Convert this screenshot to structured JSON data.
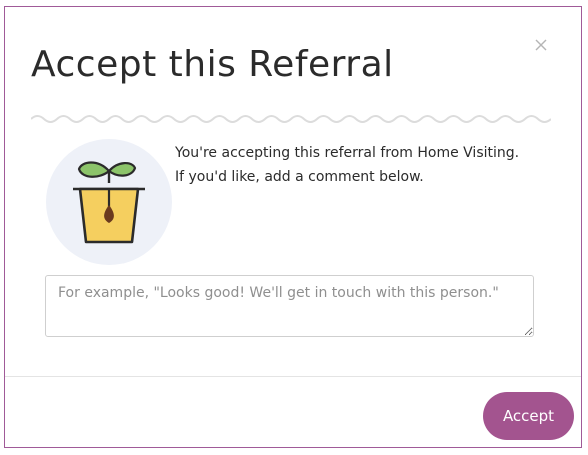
{
  "dialog": {
    "title": "Accept this Referral",
    "close_icon": "close-icon",
    "illustration_icon": "seedling-pot-icon",
    "message_line1": "You're accepting this referral from Home Visiting.",
    "message_line2": "If you'd like, add a comment below.",
    "comment": {
      "value": "",
      "placeholder": "For example, \"Looks good! We'll get in touch with this person.\""
    },
    "accept_label": "Accept"
  },
  "colors": {
    "accent": "#a3548f",
    "border": "#a05a98",
    "pot": "#f5cf5f",
    "leaf": "#8cc46a",
    "seed": "#6a3a1e",
    "circle": "#eef1f8",
    "wave": "#dcdcdc"
  }
}
